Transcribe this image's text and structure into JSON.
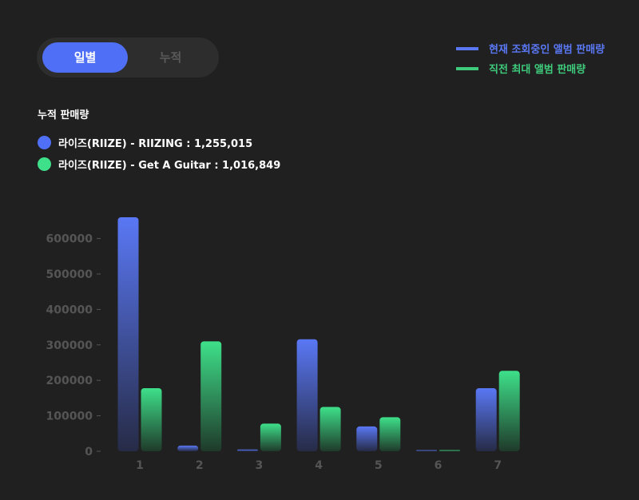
{
  "toggle": {
    "active_label": "일별",
    "inactive_label": "누적"
  },
  "legend": {
    "items": [
      {
        "label": "현재 조회중인 앨범 판매량",
        "color": "#5a78f5"
      },
      {
        "label": "직전 최대 앨범 판매량",
        "color": "#3ecb7c"
      }
    ]
  },
  "summary": {
    "title": "누적 판매량",
    "items": [
      {
        "text": "라이즈(RIIZE) - RIIZING : 1,255,015",
        "color": "#4f6ff7"
      },
      {
        "text": "라이즈(RIIZE) - Get A Guitar : 1,016,849",
        "color": "#3ee08a"
      }
    ]
  },
  "chart_data": {
    "type": "bar",
    "categories": [
      "1",
      "2",
      "3",
      "4",
      "5",
      "6",
      "7"
    ],
    "series": [
      {
        "name": "현재 조회중인 앨범 판매량",
        "values": [
          660000,
          16000,
          5000,
          316000,
          70000,
          3000,
          178000
        ],
        "color": "#5a78f5"
      },
      {
        "name": "직전 최대 앨범 판매량",
        "values": [
          178000,
          310000,
          78000,
          125000,
          96000,
          2000,
          227000
        ],
        "color": "#3ecb7c"
      }
    ],
    "yticks": [
      0,
      100000,
      200000,
      300000,
      400000,
      500000,
      600000
    ],
    "ylim": [
      0,
      660000
    ],
    "grid": false
  }
}
